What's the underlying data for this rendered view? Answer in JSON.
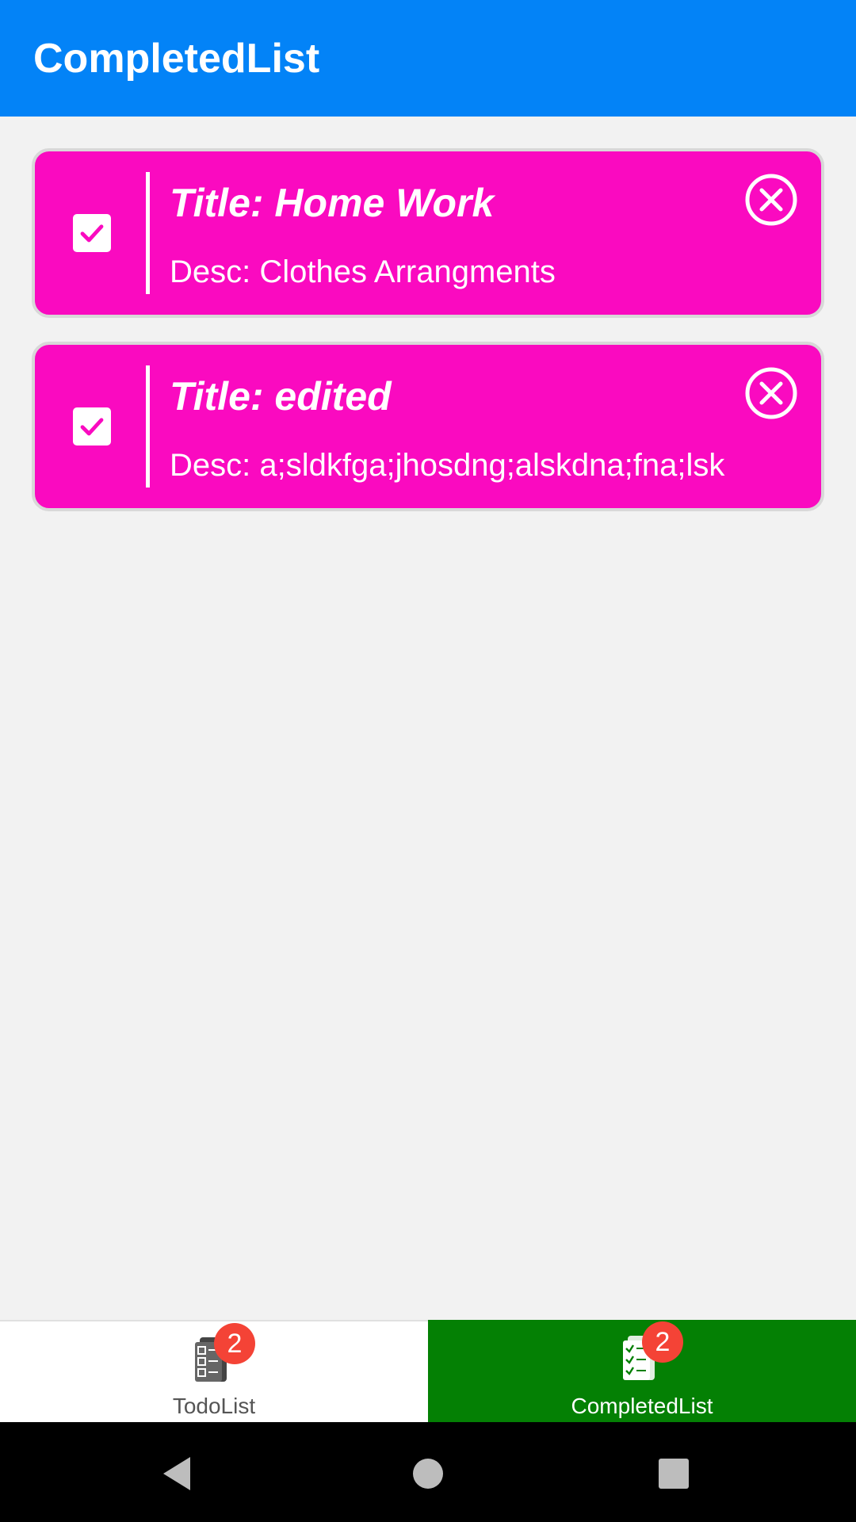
{
  "app_bar": {
    "title": "CompletedList"
  },
  "items": [
    {
      "title": "Title: Home Work",
      "desc": "Desc: Clothes Arrangments",
      "checked": true
    },
    {
      "title": "Title: edited",
      "desc": "Desc: a;sldkfga;jhosdng;alskdna;fna;lsk",
      "checked": true
    }
  ],
  "tabs": [
    {
      "label": "TodoList",
      "badge": "2",
      "icon": "checklist-icon",
      "selected": false
    },
    {
      "label": "CompletedList",
      "badge": "2",
      "icon": "checklist-icon",
      "selected": true
    }
  ],
  "system_nav": {
    "back": "back-icon",
    "home": "home-icon",
    "recents": "recents-icon"
  },
  "colors": {
    "app_bar": "#0383f7",
    "card": "#fa0ac0",
    "selected_tab": "#048004",
    "badge": "#f44336"
  }
}
